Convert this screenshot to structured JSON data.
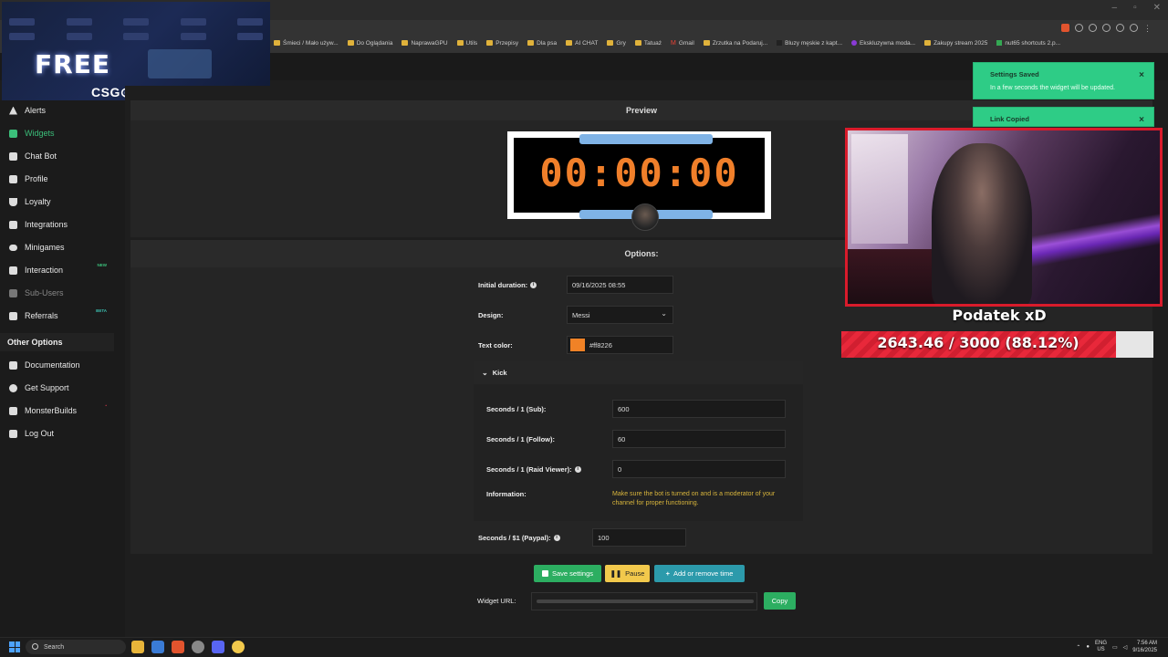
{
  "browser": {
    "bookmarks": [
      "Śmieci / Mało używ...",
      "Do Oglądania",
      "NaprawaGPU",
      "Utils",
      "Przepisy",
      "Dla psa",
      "AI CHAT",
      "Gry",
      "Tatuaż",
      "Gmail",
      "Zrzutka na Podaruj...",
      "Bluzy męskie z kapt...",
      "Ekskluzywna moda...",
      "Zakupy stream 2025",
      "nut65 shortcuts 2.p..."
    ]
  },
  "overlay_ad": {
    "headline": "FREE",
    "brand": "CSG⊙SKINS"
  },
  "sidebar": {
    "items": [
      {
        "label": "Alerts"
      },
      {
        "label": "Widgets"
      },
      {
        "label": "Chat Bot"
      },
      {
        "label": "Profile"
      },
      {
        "label": "Loyalty"
      },
      {
        "label": "Integrations"
      },
      {
        "label": "Minigames"
      },
      {
        "label": "Interaction",
        "badge": "NEW"
      },
      {
        "label": "Sub-Users"
      },
      {
        "label": "Referrals",
        "badge": "BETA"
      }
    ],
    "other_heading": "Other Options",
    "other_items": [
      {
        "label": "Documentation"
      },
      {
        "label": "Get Support"
      },
      {
        "label": "MonsterBuilds"
      },
      {
        "label": "Log Out"
      }
    ]
  },
  "preview": {
    "heading": "Preview",
    "timer": "00:00:00"
  },
  "options": {
    "heading": "Options:",
    "initial_duration_label": "Initial duration:",
    "initial_duration_value": "09/16/2025 08:55",
    "design_label": "Design:",
    "design_value": "Messi",
    "text_color_label": "Text color:",
    "text_color_value": "#ff8226",
    "kick": {
      "heading": "Kick",
      "sub_label": "Seconds / 1 (Sub):",
      "sub_value": "600",
      "follow_label": "Seconds / 1 (Follow):",
      "follow_value": "60",
      "raid_label": "Seconds / 1 (Raid Viewer):",
      "raid_value": "0",
      "info_label": "Information:",
      "info_text": "Make sure the bot is turned on and is a moderator of your channel for proper functioning."
    },
    "paypal_label": "Seconds / $1 (Paypal):",
    "paypal_value": "100"
  },
  "actions": {
    "save": "Save settings",
    "pause": "Pause",
    "add_remove": "Add or remove time",
    "widget_url_label": "Widget URL:",
    "copy": "Copy"
  },
  "toasts": [
    {
      "title": "Settings Saved",
      "message": "In a few seconds the widget will be updated."
    },
    {
      "title": "Link Copied"
    }
  ],
  "goal": {
    "title": "Podatek xD",
    "text": "2643.46 / 3000 (88.12%)",
    "current": 2643.46,
    "target": 3000,
    "progress": 0.8812
  },
  "taskbar": {
    "search": "Search",
    "lang_top": "ENG",
    "lang_bottom": "US",
    "time": "7:56 AM",
    "date": "9/16/2025"
  },
  "colors": {
    "accent_green": "#2cae61",
    "timer_orange": "#f07f2a",
    "goal_red": "#e8283a"
  }
}
